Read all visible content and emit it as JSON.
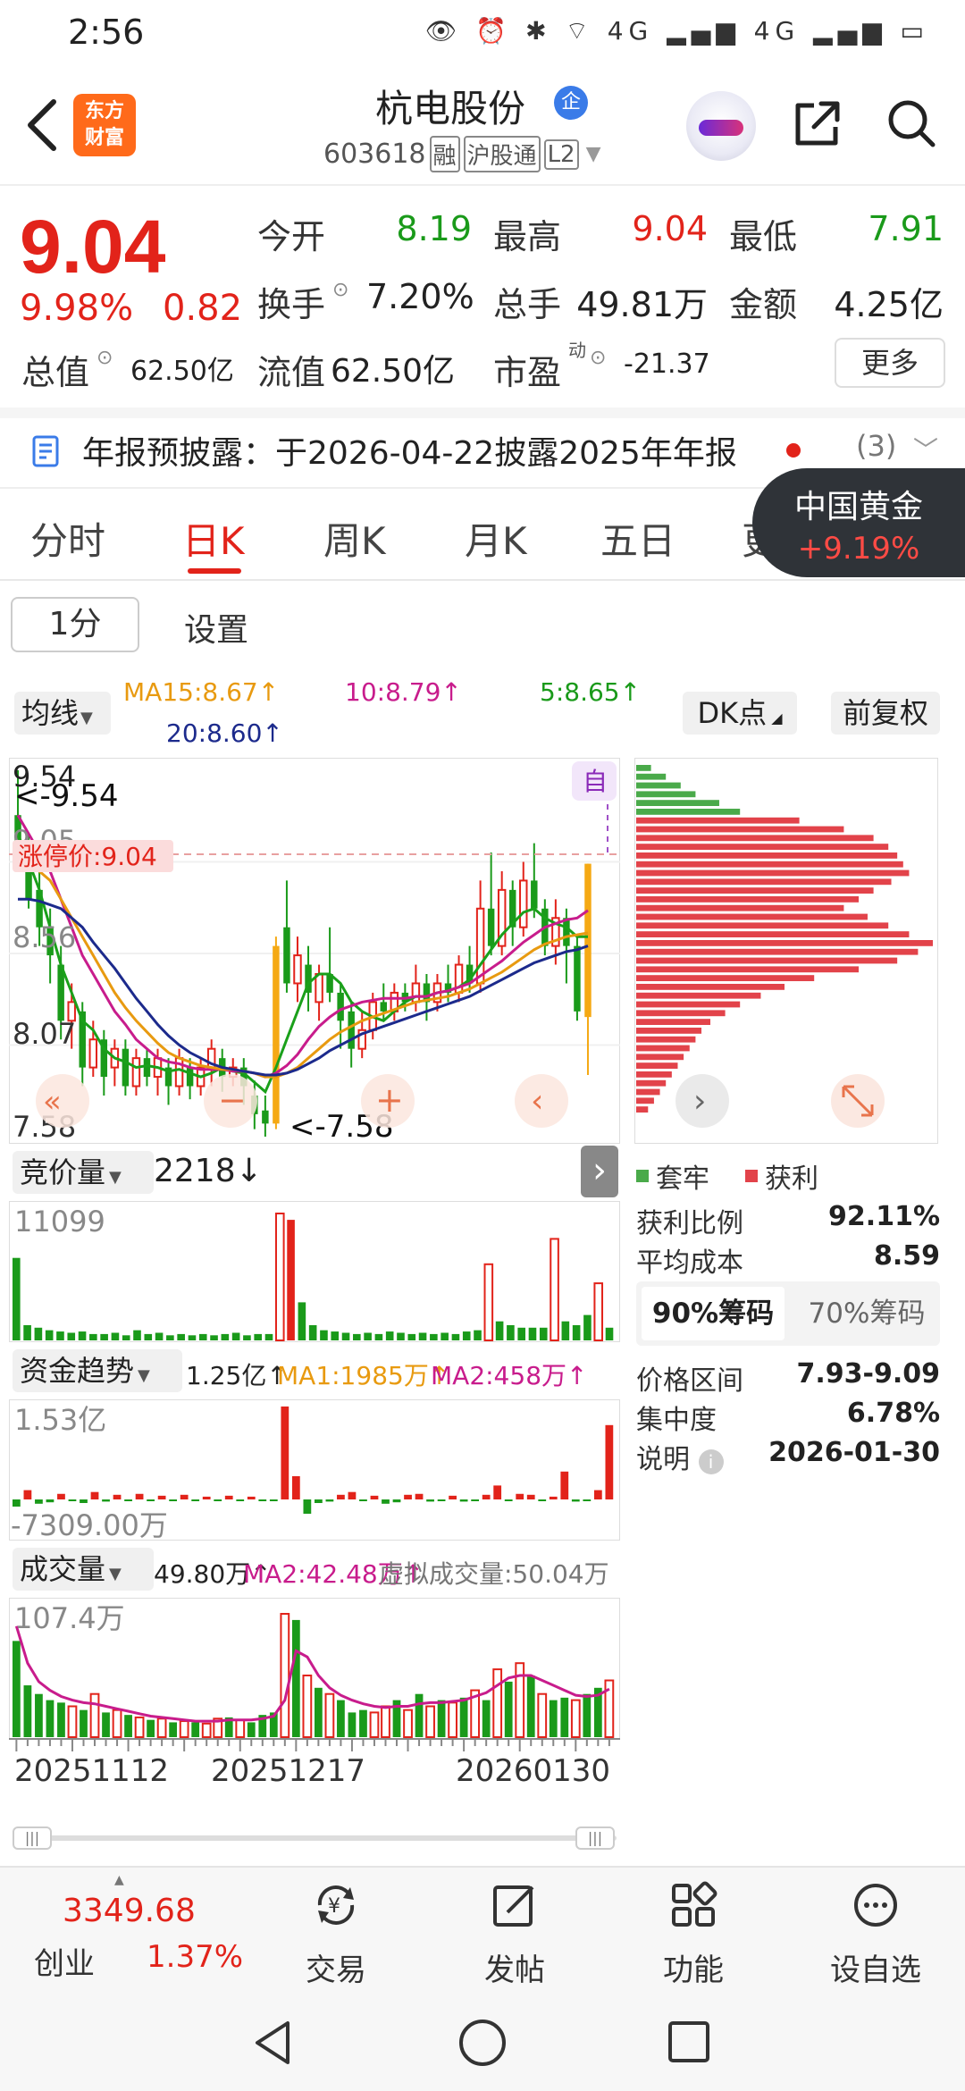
{
  "status": {
    "time": "2:56",
    "icons": "👁 ⏰ ✱ ⌔ 4G ▂▄▆ 4G ▂▄▆ ▭"
  },
  "header": {
    "logo_line1": "东方",
    "logo_line2": "财富",
    "stock_name": "杭电股份",
    "qi_badge": "企",
    "code": "603618",
    "tag_rong": "融",
    "tag_hgt": "沪股通",
    "tag_l2": "L2"
  },
  "quote": {
    "price": "9.04",
    "pct": "9.98%",
    "change": "0.82",
    "open_label": "今开",
    "open": "8.19",
    "high_label": "最高",
    "high": "9.04",
    "low_label": "最低",
    "low": "7.91",
    "turnover_label": "换手",
    "turnover": "7.20%",
    "volume_label": "总手",
    "volume": "49.81万",
    "amount_label": "金额",
    "amount": "4.25亿",
    "total_cap_label": "总值",
    "total_cap": "62.50亿",
    "float_cap_label": "流值",
    "float_cap": "62.50亿",
    "pe_label": "市盈",
    "pe_sup": "动",
    "pe": "-21.37",
    "more_label": "更多"
  },
  "notice": {
    "text": "年报预披露：于2026-04-22披露2025年年报",
    "count": "(3)"
  },
  "tabs": [
    "分时",
    "日K",
    "周K",
    "月K",
    "五日",
    "更"
  ],
  "gold_badge": {
    "name": "中国黄金",
    "pct": "+9.19%"
  },
  "subcontrols": {
    "period": "1分",
    "settings": "设置"
  },
  "ma_legend": {
    "select_label": "均线",
    "ma15": "MA15:8.67↑",
    "ma10": "10:8.79↑",
    "ma5": "5:8.65↑",
    "ma20": "20:8.60↑",
    "dk_label": "DK点",
    "fq_label": "前复权"
  },
  "kline": {
    "y_labels": [
      "9.54",
      "9.05",
      "8.56",
      "8.07",
      "7.58"
    ],
    "high_marker": "<-9.54",
    "low_marker": "<-7.58",
    "limit_label": "涨停价:9.04",
    "zi_badge": "自"
  },
  "chips": {
    "legend_trapped": "套牢",
    "legend_profit": "获利",
    "profit_ratio_label": "获利比例",
    "profit_ratio": "92.11%",
    "avg_cost_label": "平均成本",
    "avg_cost": "8.59",
    "tab_90": "90%筹码",
    "tab_70": "70%筹码",
    "range_label": "价格区间",
    "range": "7.93-9.09",
    "concentration_label": "集中度",
    "concentration": "6.78%",
    "note_label": "说明",
    "note_date": "2026-01-30"
  },
  "auction": {
    "select_label": "竞价量",
    "value": "2218↓",
    "max_label": "11099"
  },
  "fund": {
    "select_label": "资金趋势",
    "value": "1.25亿↑",
    "ma1": "MA1:1985万↑",
    "ma2": "MA2:458万↑",
    "max_label": "1.53亿",
    "min_label": "-7309.00万"
  },
  "volume_panel": {
    "select_label": "成交量",
    "value": "49.80万↑",
    "ma2": "MA2:42.48万↑",
    "virtual": "虚拟成交量:50.04万",
    "max_label": "107.4万"
  },
  "dates": [
    "20251112",
    "20251217",
    "20260130"
  ],
  "bottom_bar": {
    "index_value": "3349.68",
    "index_name": "创业",
    "index_pct": "1.37%",
    "items": [
      "交易",
      "发帖",
      "功能",
      "设自选"
    ]
  },
  "colors": {
    "up": "#e2231a",
    "down": "#1a9a1a",
    "ma5": "#1aa01a",
    "ma10": "#c81c8c",
    "ma15": "#e89a10",
    "ma20": "#1c2a8c"
  },
  "chart_data": {
    "type": "candlestick",
    "y_range": [
      7.58,
      9.54
    ],
    "candles": [
      [
        9.3,
        9.1,
        9.54,
        9.0
      ],
      [
        9.1,
        8.85,
        9.2,
        8.8
      ],
      [
        8.9,
        8.7,
        9.0,
        8.6
      ],
      [
        8.7,
        8.55,
        8.8,
        8.4
      ],
      [
        8.5,
        8.2,
        8.6,
        8.1
      ],
      [
        8.2,
        8.3,
        8.4,
        8.05
      ],
      [
        8.25,
        7.95,
        8.3,
        7.85
      ],
      [
        7.95,
        8.1,
        8.2,
        7.9
      ],
      [
        8.1,
        7.9,
        8.15,
        7.8
      ],
      [
        7.95,
        8.05,
        8.1,
        7.85
      ],
      [
        8.05,
        7.85,
        8.1,
        7.8
      ],
      [
        7.85,
        8.0,
        8.05,
        7.8
      ],
      [
        8.0,
        7.9,
        8.05,
        7.85
      ],
      [
        7.9,
        8.0,
        8.05,
        7.8
      ],
      [
        7.95,
        7.85,
        8.0,
        7.75
      ],
      [
        7.85,
        8.0,
        8.05,
        7.8
      ],
      [
        7.95,
        7.85,
        8.0,
        7.78
      ],
      [
        7.85,
        7.95,
        8.0,
        7.8
      ],
      [
        7.95,
        8.05,
        8.1,
        7.85
      ],
      [
        8.0,
        7.9,
        8.05,
        7.82
      ],
      [
        7.9,
        7.95,
        8.0,
        7.85
      ],
      [
        7.95,
        7.85,
        8.0,
        7.75
      ],
      [
        7.8,
        7.7,
        7.88,
        7.62
      ],
      [
        7.72,
        7.65,
        7.8,
        7.58
      ],
      [
        7.65,
        8.6,
        8.65,
        7.62
      ],
      [
        8.7,
        8.4,
        8.95,
        8.35
      ],
      [
        8.4,
        8.55,
        8.65,
        8.3
      ],
      [
        8.5,
        8.35,
        8.6,
        8.25
      ],
      [
        8.3,
        8.45,
        8.5,
        8.2
      ],
      [
        8.45,
        8.35,
        8.7,
        8.3
      ],
      [
        8.35,
        8.2,
        8.4,
        8.05
      ],
      [
        8.25,
        8.05,
        8.3,
        7.95
      ],
      [
        8.05,
        8.15,
        8.25,
        8.0
      ],
      [
        8.15,
        8.3,
        8.35,
        8.1
      ],
      [
        8.3,
        8.25,
        8.4,
        8.2
      ],
      [
        8.25,
        8.35,
        8.4,
        8.2
      ],
      [
        8.35,
        8.3,
        8.4,
        8.25
      ],
      [
        8.3,
        8.4,
        8.5,
        8.25
      ],
      [
        8.4,
        8.3,
        8.45,
        8.2
      ],
      [
        8.3,
        8.4,
        8.45,
        8.25
      ],
      [
        8.4,
        8.35,
        8.5,
        8.3
      ],
      [
        8.35,
        8.5,
        8.55,
        8.3
      ],
      [
        8.5,
        8.4,
        8.6,
        8.35
      ],
      [
        8.4,
        8.8,
        8.95,
        8.35
      ],
      [
        8.8,
        8.6,
        9.1,
        8.55
      ],
      [
        8.6,
        8.9,
        9.0,
        8.55
      ],
      [
        8.9,
        8.7,
        8.95,
        8.6
      ],
      [
        8.7,
        8.95,
        9.05,
        8.65
      ],
      [
        8.95,
        8.8,
        9.15,
        8.75
      ],
      [
        8.8,
        8.6,
        8.85,
        8.55
      ],
      [
        8.6,
        8.75,
        8.85,
        8.5
      ],
      [
        8.75,
        8.6,
        8.8,
        8.4
      ],
      [
        8.6,
        8.25,
        8.65,
        8.2
      ],
      [
        8.22,
        9.04,
        9.04,
        7.91
      ]
    ],
    "ma5": [
      9.2,
      9.05,
      8.9,
      8.7,
      8.5,
      8.35,
      8.2,
      8.15,
      8.05,
      8.0,
      7.98,
      7.95,
      7.96,
      7.95,
      7.93,
      7.94,
      7.92,
      7.9,
      7.92,
      7.95,
      7.93,
      7.92,
      7.87,
      7.82,
      7.95,
      8.1,
      8.25,
      8.4,
      8.45,
      8.45,
      8.4,
      8.3,
      8.25,
      8.22,
      8.2,
      8.25,
      8.3,
      8.33,
      8.33,
      8.35,
      8.36,
      8.38,
      8.42,
      8.5,
      8.58,
      8.66,
      8.72,
      8.78,
      8.8,
      8.75,
      8.72,
      8.7,
      8.65,
      8.65
    ],
    "ma10": [
      9.3,
      9.2,
      9.1,
      9.0,
      8.85,
      8.7,
      8.55,
      8.45,
      8.35,
      8.25,
      8.18,
      8.1,
      8.05,
      8.0,
      7.98,
      7.97,
      7.95,
      7.94,
      7.94,
      7.94,
      7.93,
      7.93,
      7.92,
      7.9,
      7.92,
      7.96,
      8.02,
      8.1,
      8.17,
      8.22,
      8.26,
      8.28,
      8.3,
      8.31,
      8.32,
      8.32,
      8.32,
      8.33,
      8.33,
      8.35,
      8.36,
      8.38,
      8.4,
      8.44,
      8.48,
      8.52,
      8.57,
      8.62,
      8.66,
      8.7,
      8.72,
      8.74,
      8.75,
      8.79
    ],
    "ma15": [
      9.1,
      9.05,
      9.0,
      8.95,
      8.85,
      8.75,
      8.65,
      8.55,
      8.45,
      8.35,
      8.27,
      8.2,
      8.14,
      8.08,
      8.03,
      8.0,
      7.98,
      7.96,
      7.95,
      7.94,
      7.94,
      7.93,
      7.92,
      7.9,
      7.9,
      7.92,
      7.95,
      8.0,
      8.05,
      8.1,
      8.14,
      8.17,
      8.2,
      8.22,
      8.24,
      8.26,
      8.28,
      8.3,
      8.31,
      8.32,
      8.33,
      8.35,
      8.37,
      8.4,
      8.43,
      8.46,
      8.5,
      8.54,
      8.58,
      8.61,
      8.63,
      8.65,
      8.66,
      8.67
    ],
    "ma20": [
      8.85,
      8.85,
      8.84,
      8.82,
      8.8,
      8.75,
      8.7,
      8.62,
      8.55,
      8.48,
      8.4,
      8.32,
      8.25,
      8.18,
      8.12,
      8.07,
      8.03,
      8.0,
      7.97,
      7.95,
      7.94,
      7.93,
      7.92,
      7.91,
      7.91,
      7.92,
      7.94,
      7.97,
      8.0,
      8.04,
      8.07,
      8.1,
      8.13,
      8.15,
      8.17,
      8.19,
      8.21,
      8.23,
      8.25,
      8.27,
      8.29,
      8.31,
      8.33,
      8.36,
      8.39,
      8.42,
      8.45,
      8.48,
      8.51,
      8.53,
      8.55,
      8.57,
      8.58,
      8.6
    ],
    "chips_profile": [
      0.05,
      0.1,
      0.15,
      0.2,
      0.28,
      0.35,
      0.55,
      0.7,
      0.8,
      0.85,
      0.88,
      0.9,
      0.92,
      0.86,
      0.8,
      0.75,
      0.7,
      0.78,
      0.85,
      0.92,
      1.0,
      0.95,
      0.88,
      0.75,
      0.6,
      0.5,
      0.42,
      0.35,
      0.3,
      0.25,
      0.22,
      0.2,
      0.18,
      0.16,
      0.14,
      0.12,
      0.1,
      0.08,
      0.06,
      0.04
    ],
    "chips_split": 0.15,
    "auction_values": [
      0.65,
      0.12,
      0.1,
      0.08,
      0.07,
      0.06,
      0.07,
      0.05,
      0.05,
      0.06,
      0.04,
      0.08,
      0.05,
      0.06,
      0.04,
      0.05,
      0.04,
      0.05,
      0.04,
      0.05,
      0.06,
      0.04,
      0.05,
      0.05,
      1.0,
      0.95,
      0.3,
      0.12,
      0.08,
      0.07,
      0.06,
      0.05,
      0.06,
      0.05,
      0.07,
      0.06,
      0.05,
      0.06,
      0.05,
      0.06,
      0.05,
      0.07,
      0.08,
      0.6,
      0.15,
      0.12,
      0.1,
      0.1,
      0.1,
      0.8,
      0.15,
      0.12,
      0.2,
      0.45,
      0.1
    ],
    "fund_values": [
      -0.2,
      0.1,
      -0.12,
      -0.08,
      0.06,
      -0.05,
      -0.1,
      0.08,
      -0.06,
      0.05,
      -0.04,
      0.06,
      -0.05,
      0.04,
      -0.03,
      0.05,
      -0.04,
      0.03,
      -0.03,
      0.04,
      -0.05,
      0.03,
      -0.02,
      -0.03,
      1.0,
      0.25,
      -0.4,
      -0.1,
      -0.06,
      0.05,
      0.08,
      -0.05,
      0.04,
      -0.12,
      -0.08,
      0.05,
      0.06,
      -0.06,
      -0.05,
      0.04,
      -0.06,
      -0.04,
      0.05,
      0.15,
      -0.05,
      0.06,
      0.05,
      -0.04,
      0.03,
      0.3,
      -0.06,
      -0.05,
      0.1,
      0.8
    ],
    "volume_values": [
      0.78,
      0.42,
      0.35,
      0.3,
      0.28,
      0.25,
      0.22,
      0.35,
      0.2,
      0.22,
      0.18,
      0.16,
      0.14,
      0.15,
      0.12,
      0.13,
      0.12,
      0.11,
      0.15,
      0.16,
      0.14,
      0.12,
      0.18,
      0.2,
      1.0,
      0.95,
      0.5,
      0.4,
      0.35,
      0.3,
      0.2,
      0.22,
      0.2,
      0.25,
      0.3,
      0.22,
      0.35,
      0.25,
      0.3,
      0.28,
      0.32,
      0.38,
      0.3,
      0.55,
      0.45,
      0.6,
      0.5,
      0.35,
      0.3,
      0.32,
      0.3,
      0.35,
      0.4,
      0.46
    ],
    "volume_ma": [
      0.9,
      0.6,
      0.45,
      0.38,
      0.33,
      0.3,
      0.28,
      0.27,
      0.25,
      0.23,
      0.21,
      0.19,
      0.17,
      0.16,
      0.15,
      0.14,
      0.13,
      0.13,
      0.13,
      0.14,
      0.14,
      0.14,
      0.15,
      0.17,
      0.3,
      0.7,
      0.65,
      0.5,
      0.4,
      0.34,
      0.3,
      0.27,
      0.25,
      0.24,
      0.25,
      0.25,
      0.27,
      0.28,
      0.28,
      0.29,
      0.3,
      0.33,
      0.36,
      0.42,
      0.48,
      0.5,
      0.5,
      0.46,
      0.42,
      0.38,
      0.34,
      0.33,
      0.34,
      0.39
    ]
  }
}
